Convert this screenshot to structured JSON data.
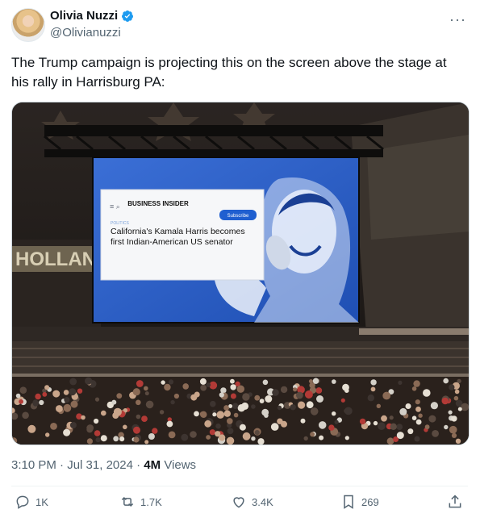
{
  "author": {
    "display_name": "Olivia Nuzzi",
    "handle": "@Olivianuzzi",
    "verified": true
  },
  "tweet": {
    "text": "The Trump campaign is projecting this on the screen above the stage at his rally in Harrisburg PA:"
  },
  "media": {
    "arena_sign": "HOLLAN",
    "screen": {
      "publication": "BUSINESS INSIDER",
      "section": "POLITICS",
      "subscribe": "Subscribe",
      "headline": "California's Kamala Harris becomes first Indian-American US senator"
    }
  },
  "meta": {
    "time": "3:10 PM",
    "date": "Jul 31, 2024",
    "views_count": "4M",
    "views_label": "Views"
  },
  "actions": {
    "replies": "1K",
    "reposts": "1.7K",
    "likes": "3.4K",
    "bookmarks": "269"
  },
  "colors": {
    "accent": "#1d9bf0",
    "screen_blue": "#2f62c9"
  }
}
